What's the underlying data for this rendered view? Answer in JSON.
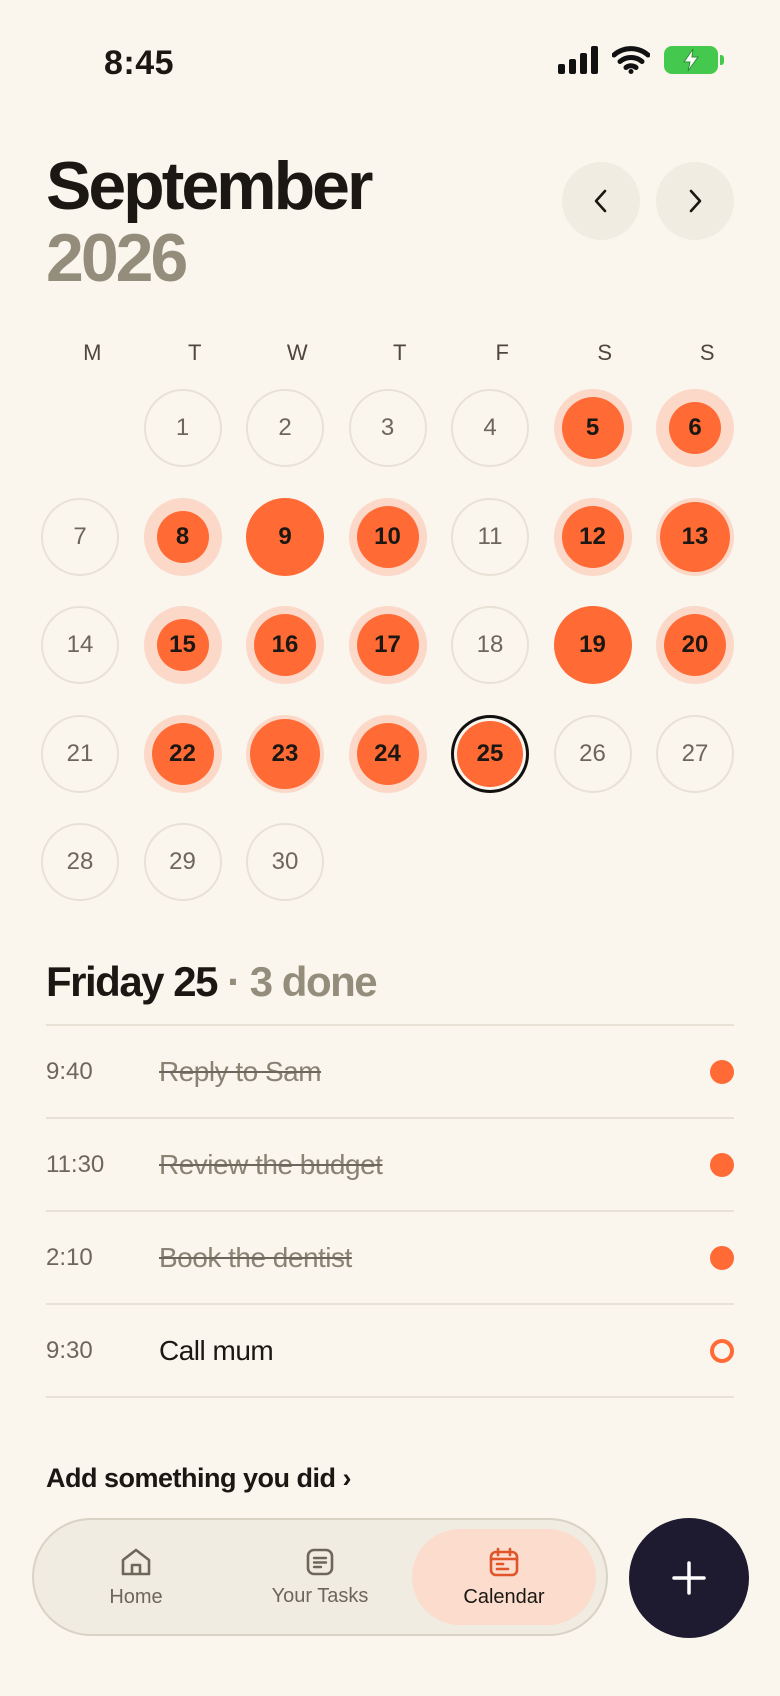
{
  "status": {
    "time": "8:45"
  },
  "header": {
    "month": "September",
    "year": "2026"
  },
  "nav": {
    "prev_icon": "chevron-left-icon",
    "next_icon": "chevron-right-icon"
  },
  "weekdays": [
    "M",
    "T",
    "W",
    "T",
    "F",
    "S",
    "S"
  ],
  "calendar": {
    "leading_blank_days": 1,
    "days": [
      {
        "n": "1",
        "state": "plain"
      },
      {
        "n": "2",
        "state": "plain"
      },
      {
        "n": "3",
        "state": "plain"
      },
      {
        "n": "4",
        "state": "plain"
      },
      {
        "n": "5",
        "state": "ring"
      },
      {
        "n": "6",
        "state": "ring-small"
      },
      {
        "n": "7",
        "state": "plain"
      },
      {
        "n": "8",
        "state": "ring-small"
      },
      {
        "n": "9",
        "state": "full"
      },
      {
        "n": "10",
        "state": "ring"
      },
      {
        "n": "11",
        "state": "plain"
      },
      {
        "n": "12",
        "state": "ring"
      },
      {
        "n": "13",
        "state": "ring-thin"
      },
      {
        "n": "14",
        "state": "plain"
      },
      {
        "n": "15",
        "state": "ring-small"
      },
      {
        "n": "16",
        "state": "ring"
      },
      {
        "n": "17",
        "state": "ring"
      },
      {
        "n": "18",
        "state": "plain"
      },
      {
        "n": "19",
        "state": "full"
      },
      {
        "n": "20",
        "state": "ring"
      },
      {
        "n": "21",
        "state": "plain"
      },
      {
        "n": "22",
        "state": "ring"
      },
      {
        "n": "23",
        "state": "ring-thin"
      },
      {
        "n": "24",
        "state": "ring"
      },
      {
        "n": "25",
        "state": "today"
      },
      {
        "n": "26",
        "state": "plain"
      },
      {
        "n": "27",
        "state": "plain"
      },
      {
        "n": "28",
        "state": "plain"
      },
      {
        "n": "29",
        "state": "plain"
      },
      {
        "n": "30",
        "state": "plain"
      }
    ]
  },
  "selected_day": {
    "title": "Friday 25",
    "done_text": "· 3 done"
  },
  "tasks": [
    {
      "time": "9:40",
      "title": "Reply to Sam",
      "done": true
    },
    {
      "time": "11:30",
      "title": "Review the budget",
      "done": true
    },
    {
      "time": "2:10",
      "title": "Book the dentist",
      "done": true
    },
    {
      "time": "9:30",
      "title": "Call mum",
      "done": false
    }
  ],
  "add_link": "Add something you did ›",
  "tabbar": {
    "tabs": [
      {
        "label": "Home",
        "icon": "home-icon",
        "active": false
      },
      {
        "label": "Your Tasks",
        "icon": "list-icon",
        "active": false
      },
      {
        "label": "Calendar",
        "icon": "calendar-icon",
        "active": true
      }
    ]
  },
  "fab": {
    "icon": "plus-icon"
  },
  "colors": {
    "accent": "#ff6a35",
    "accent_soft": "#fbd8c8",
    "background": "#faf6ee",
    "muted": "#958d7b",
    "fab": "#1e1a2f"
  }
}
